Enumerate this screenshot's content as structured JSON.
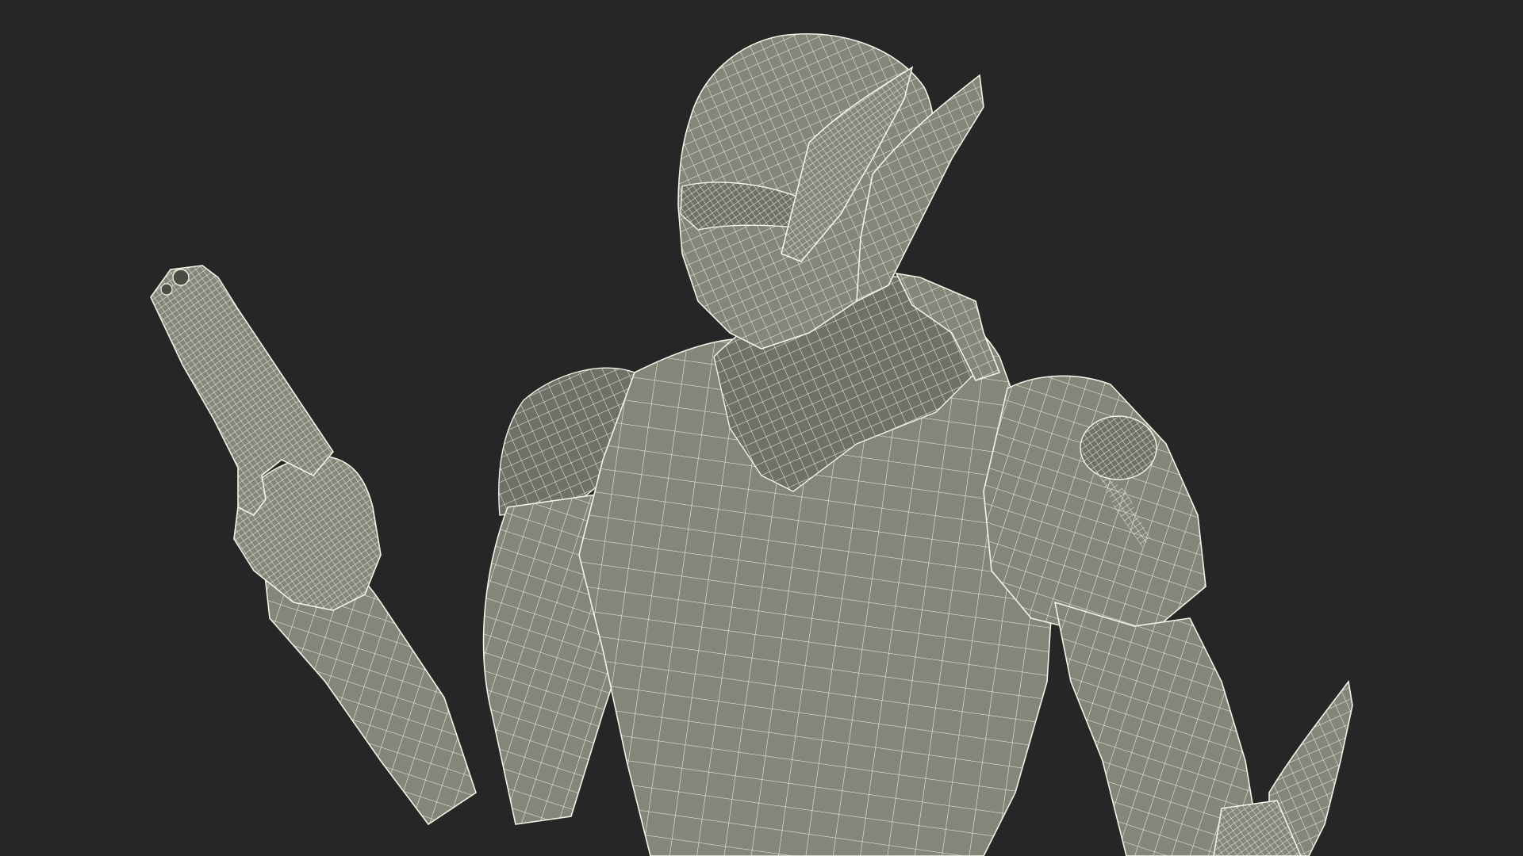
{
  "scene": {
    "background_color": "#262626",
    "surface_color": "#85867a",
    "surface_shadow_color": "#6f7066",
    "wire_color": "#f2f3e6",
    "render_style": "wireframe-over-shaded",
    "subject": "armored-humanoid-with-pistol"
  }
}
